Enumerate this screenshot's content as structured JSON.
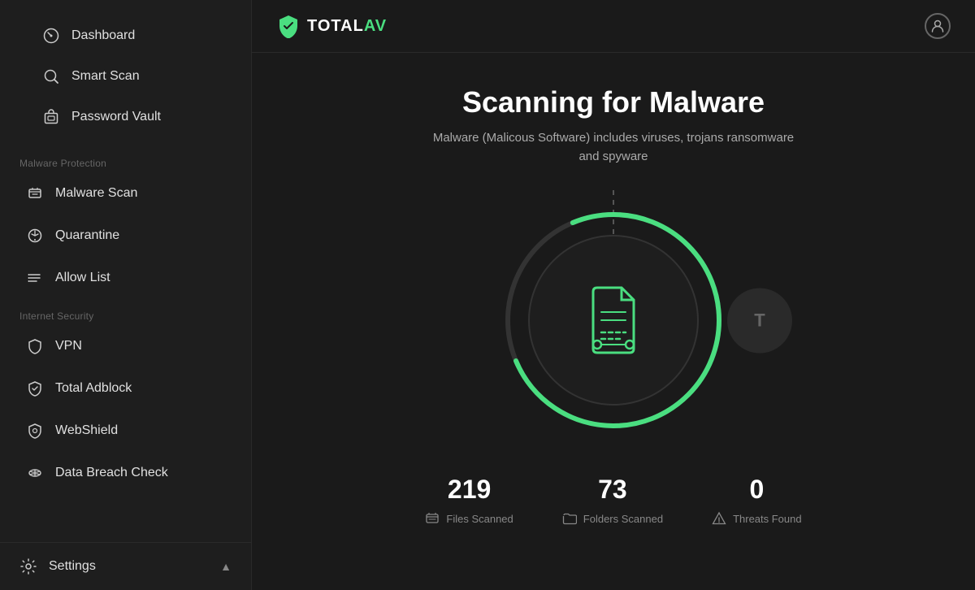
{
  "sidebar": {
    "nav_items": [
      {
        "id": "dashboard",
        "label": "Dashboard",
        "icon": "dashboard-icon"
      },
      {
        "id": "smart-scan",
        "label": "Smart Scan",
        "icon": "scan-icon"
      },
      {
        "id": "password-vault",
        "label": "Password Vault",
        "icon": "vault-icon"
      }
    ],
    "malware_section_label": "Malware Protection",
    "malware_items": [
      {
        "id": "malware-scan",
        "label": "Malware Scan",
        "icon": "malware-scan-icon"
      },
      {
        "id": "quarantine",
        "label": "Quarantine",
        "icon": "quarantine-icon"
      },
      {
        "id": "allow-list",
        "label": "Allow List",
        "icon": "allow-list-icon"
      }
    ],
    "internet_section_label": "Internet Security",
    "internet_items": [
      {
        "id": "vpn",
        "label": "VPN",
        "icon": "vpn-icon"
      },
      {
        "id": "adblock",
        "label": "Total Adblock",
        "icon": "adblock-icon"
      },
      {
        "id": "webshield",
        "label": "WebShield",
        "icon": "webshield-icon"
      },
      {
        "id": "breach-check",
        "label": "Data Breach Check",
        "icon": "breach-icon"
      }
    ],
    "settings_label": "Settings",
    "settings_icon": "settings-icon"
  },
  "topbar": {
    "logo_total": "TOTAL",
    "logo_av": "AV",
    "user_icon": "user-icon"
  },
  "main": {
    "title": "Scanning for Malware",
    "subtitle": "Malware (Malicous Software) includes viruses, trojans ransomware\nand spyware",
    "stats": [
      {
        "id": "files-scanned",
        "value": "219",
        "label": "Files Scanned"
      },
      {
        "id": "folders-scanned",
        "value": "73",
        "label": "Folders Scanned"
      },
      {
        "id": "threats-found",
        "value": "0",
        "label": "Threats Found"
      }
    ]
  },
  "colors": {
    "green": "#4ade80",
    "bg_dark": "#1a1a1a",
    "sidebar_bg": "#1e1e1e",
    "ring_track": "#333333",
    "ring_progress": "#4ade80"
  }
}
